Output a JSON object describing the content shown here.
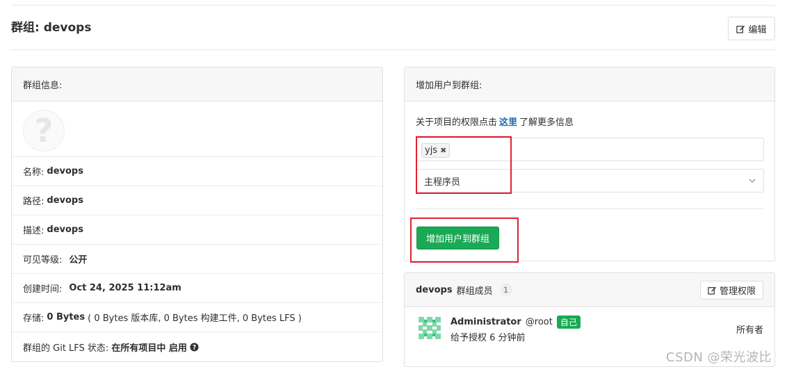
{
  "page": {
    "title_prefix": "群组: ",
    "title_name": "devops",
    "edit_label": "编辑"
  },
  "group_info": {
    "heading": "群组信息:",
    "avatar_glyph": "?",
    "rows": [
      {
        "label": "名称:",
        "value": "devops"
      },
      {
        "label": "路径:",
        "value": "devops"
      },
      {
        "label": "描述:",
        "value": "devops"
      },
      {
        "label": "可见等级:",
        "value": "公开"
      },
      {
        "label": "创建时间:",
        "value": "Oct 24, 2025 11:12am"
      }
    ],
    "storage": {
      "label": "存储:",
      "value": "0 Bytes",
      "detail": "( 0 Bytes 版本库, 0 Bytes 构建工件, 0 Bytes LFS )"
    },
    "lfs": {
      "label": "群组的 Git LFS 状态:",
      "value": "在所有项目中 启用",
      "help_icon": "question-circle-icon"
    }
  },
  "add_user": {
    "heading": "增加用户到群组:",
    "perm_prefix": "关于项目的权限点击",
    "perm_link": "这里",
    "perm_suffix": "了解更多信息",
    "selected_user": "yjs",
    "remove_glyph": "✖",
    "role_value": "主程序员",
    "submit_label": "增加用户到群组"
  },
  "members": {
    "group_name": "devops",
    "heading_suffix": "群组成员",
    "count": "1",
    "manage_label": "管理权限",
    "items": [
      {
        "name": "Administrator",
        "username": "@root",
        "badge": "自己",
        "granted": "给予授权 6 分钟前",
        "role": "所有者"
      }
    ]
  },
  "watermark": "CSDN @荣光波比",
  "colors": {
    "primary_green": "#1aaa55",
    "link_blue": "#1b69b6",
    "highlight_red": "#e2202f"
  }
}
